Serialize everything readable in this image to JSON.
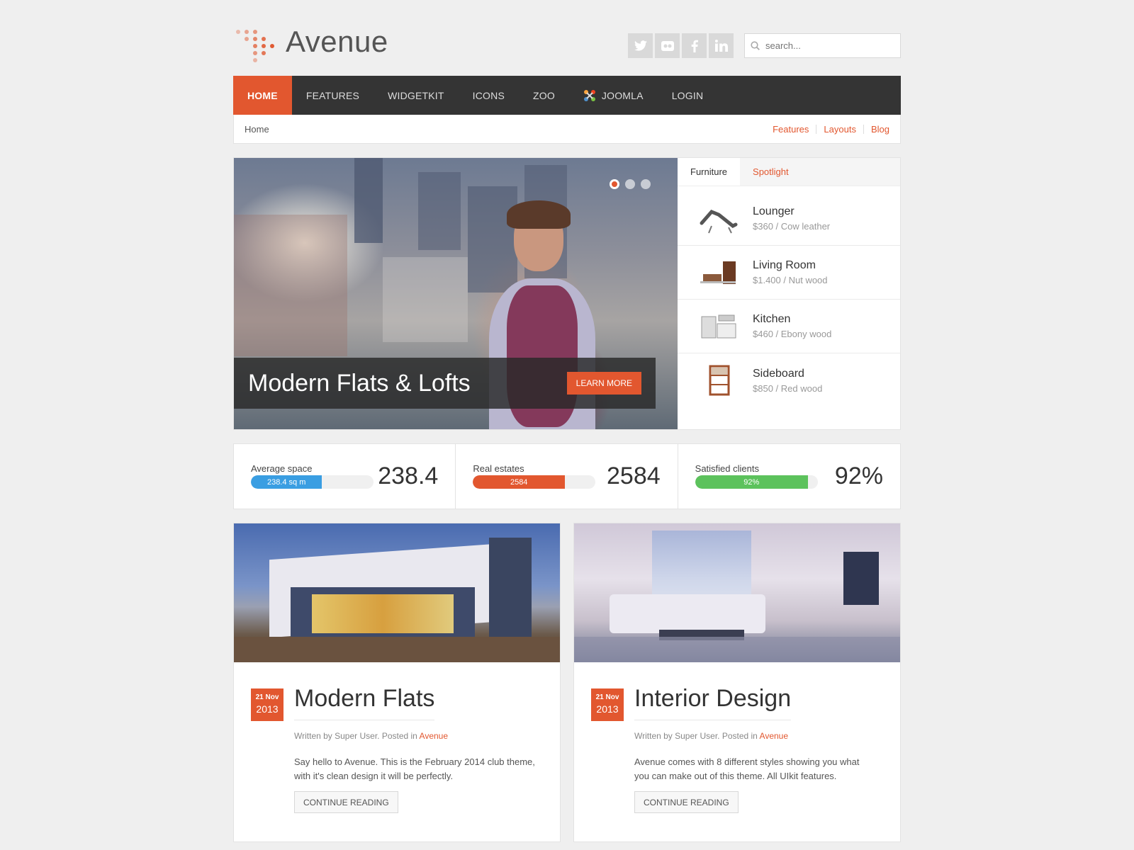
{
  "brand": {
    "name": "Avenue",
    "accent": "#e2572f"
  },
  "social": [
    {
      "icon": "twitter-icon",
      "glyph": "t"
    },
    {
      "icon": "flickr-icon",
      "glyph": "••"
    },
    {
      "icon": "facebook-icon",
      "glyph": "f"
    },
    {
      "icon": "linkedin-icon",
      "glyph": "in"
    }
  ],
  "search": {
    "placeholder": "search..."
  },
  "nav": {
    "items": [
      "HOME",
      "FEATURES",
      "WIDGETKIT",
      "ICONS",
      "ZOO",
      "JOOMLA",
      "LOGIN"
    ]
  },
  "breadcrumb": {
    "home": "Home",
    "links": [
      "Features",
      "Layouts",
      "Blog"
    ]
  },
  "hero": {
    "caption": "Modern Flats & Lofts",
    "button": "LEARN MORE"
  },
  "tabs": {
    "active": "Furniture",
    "inactive": "Spotlight"
  },
  "furniture": [
    {
      "name": "Lounger",
      "meta": "$360 / Cow leather"
    },
    {
      "name": "Living Room",
      "meta": "$1.400 / Nut wood"
    },
    {
      "name": "Kitchen",
      "meta": "$460 / Ebony wood"
    },
    {
      "name": "Sideboard",
      "meta": "$850 / Red wood"
    }
  ],
  "stats": [
    {
      "label": "Average space",
      "bar_text": "238.4 sq m",
      "value": "238.4",
      "fill_percent": 58,
      "color": "#3a9ee2"
    },
    {
      "label": "Real estates",
      "bar_text": "2584",
      "value": "2584",
      "fill_percent": 75,
      "color": "#e2572f"
    },
    {
      "label": "Satisfied clients",
      "bar_text": "92%",
      "value": "92%",
      "fill_percent": 92,
      "color": "#5cc25c"
    }
  ],
  "articles": [
    {
      "day": "21 Nov",
      "year": "2013",
      "title": "Modern Flats",
      "meta_prefix": "Written by Super User. Posted in ",
      "category": "Avenue",
      "text": "Say hello to Avenue. This is the February 2014 club theme, with it's clean design it will be perfectly.",
      "button": "CONTINUE READING"
    },
    {
      "day": "21 Nov",
      "year": "2013",
      "title": "Interior Design",
      "meta_prefix": "Written by Super User. Posted in ",
      "category": "Avenue",
      "text": "Avenue comes with 8 different styles showing you what you can make out of this theme. All UIkit features.",
      "button": "CONTINUE READING"
    }
  ]
}
